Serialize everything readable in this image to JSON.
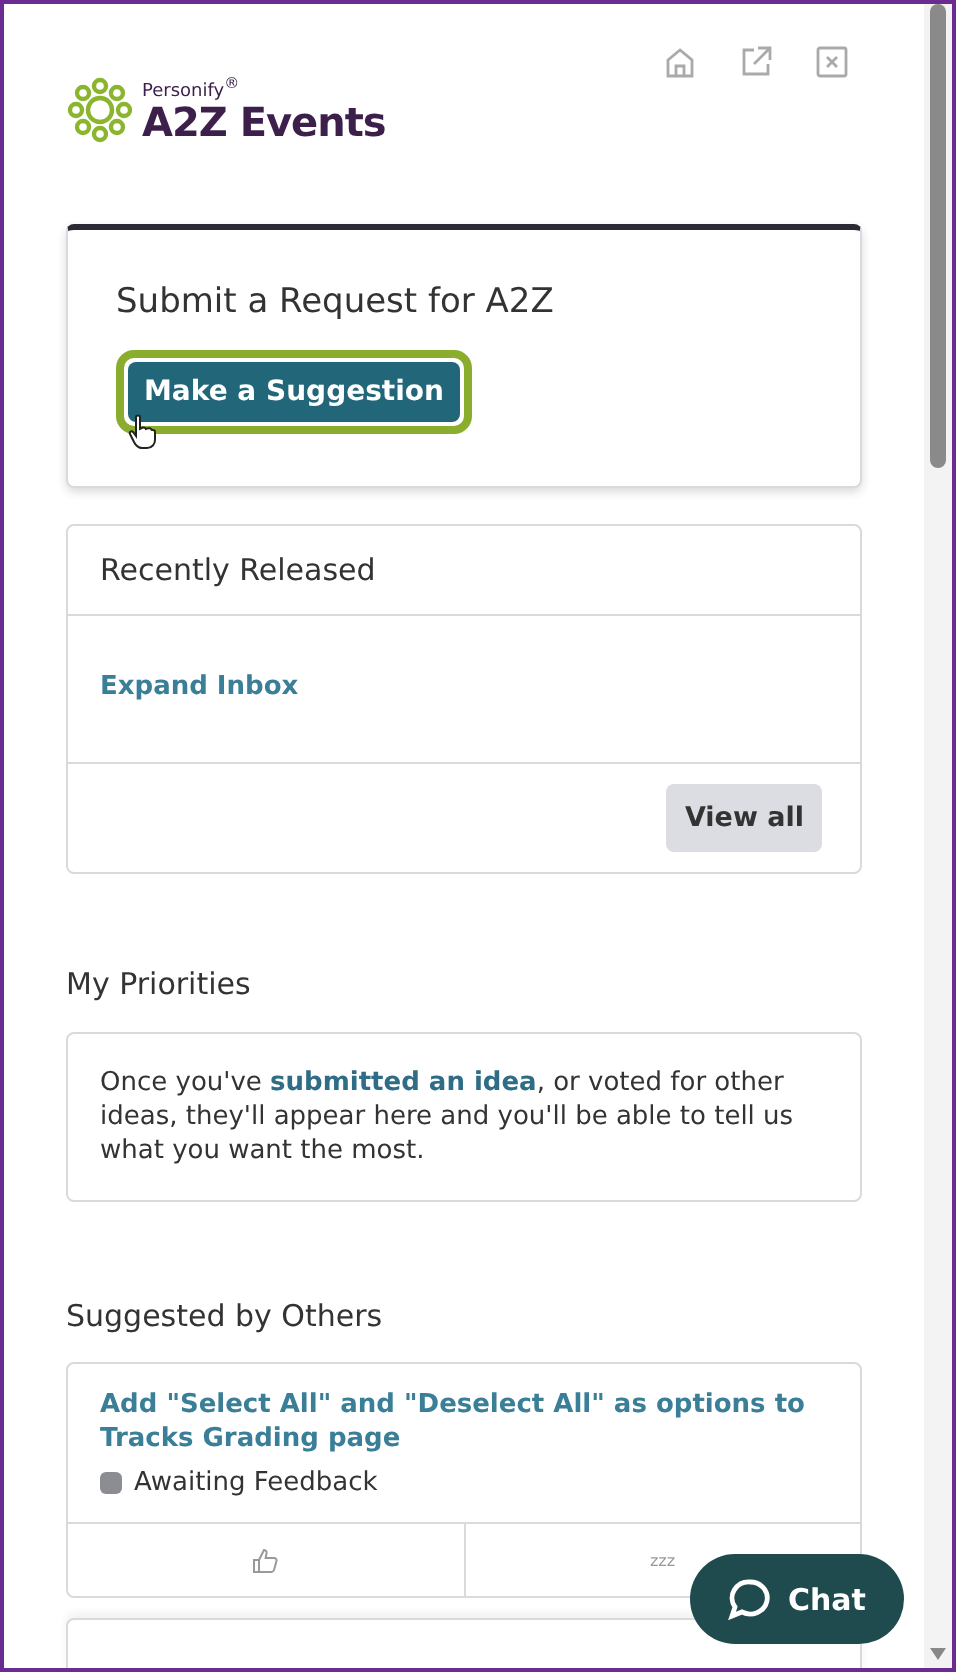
{
  "header": {
    "brand_small": "Personify$^{®}$",
    "brand": "A2Z Events"
  },
  "request_card": {
    "title": "Submit a Request for A2Z",
    "button": "Make a Suggestion",
    "focused": true
  },
  "recent": {
    "title": "Recently Released",
    "items": [
      "Expand Inbox"
    ],
    "button": "View all"
  },
  "priorities": {
    "title": "My Priorities",
    "before": "Once you've ",
    "link": "submitted an idea",
    "after": ", or voted for other ideas, they'll appear here and you'll be able to tell us what you want the most."
  },
  "suggested": {
    "title": "Suggested by Others",
    "ideas": [
      {
        "title": "Add \"Select All\" and \"Deselect All\" as options to Tracks Grading page",
        "status": "Awaiting Feedback",
        "color": "#8c8c93",
        "sleep": "zzz"
      }
    ]
  },
  "chat": {
    "label": "Chat"
  }
}
